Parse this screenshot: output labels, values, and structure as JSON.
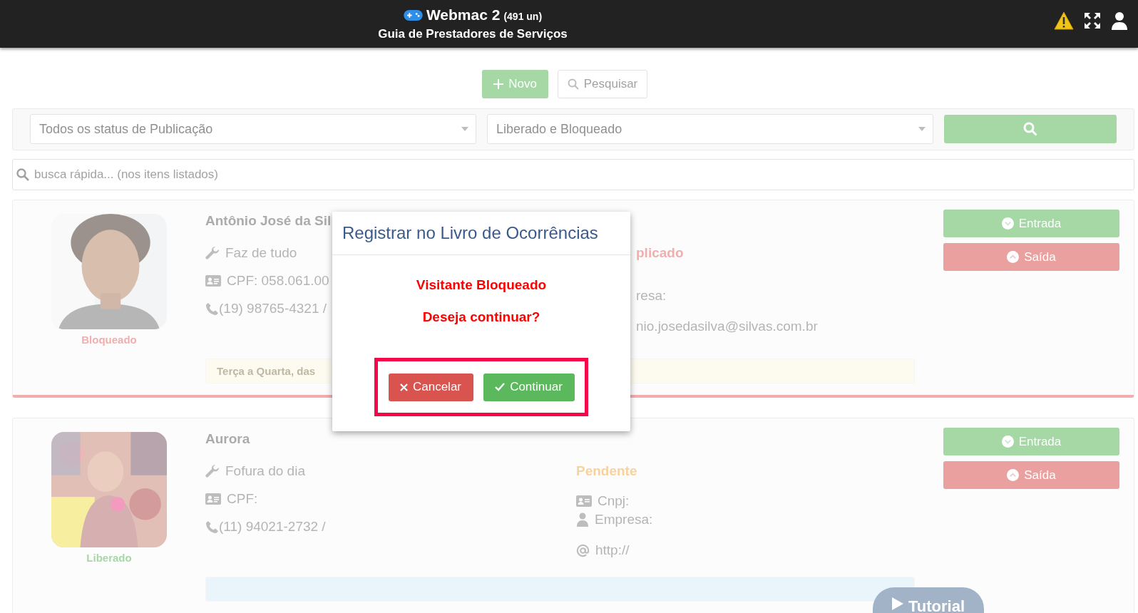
{
  "header": {
    "app_name": "Webmac 2",
    "count": "(491 un)",
    "subtitle": "Guia de Prestadores de Serviços"
  },
  "toolbar": {
    "new_button": "Novo",
    "search_button": "Pesquisar"
  },
  "filters": {
    "publication_status": "Todos os status de Publicação",
    "access_status": "Liberado e Bloqueado"
  },
  "quick_search": {
    "placeholder": "busca rápida... (nos itens listados)"
  },
  "cards": [
    {
      "name": "Antônio José da Sil",
      "service": "Faz de tudo",
      "cpf": "CPF: 058.061.00",
      "phone": "(19) 98765-4321 /",
      "access": {
        "label": "Bloqueado",
        "kind": "blocked"
      },
      "publication": {
        "text": "plicado",
        "kind": "blocked"
      },
      "details": [
        {
          "kind": "text",
          "text": "resa:"
        },
        {
          "kind": "text",
          "text": "nio.josedasilva@silvas.com.br"
        }
      ],
      "schedule": {
        "text": "Terça a Quarta, das",
        "kind": "warning"
      },
      "clipped": true,
      "entry_button": "Entrada",
      "exit_button": "Saída"
    },
    {
      "name": "Aurora",
      "service": "Fofura do dia",
      "cpf": "CPF:",
      "phone": "(11) 94021-2732 /",
      "access": {
        "label": "Liberado",
        "kind": "released"
      },
      "publication": {
        "text": "Pendente",
        "kind": "pending"
      },
      "details": [
        {
          "kind": "cnpj",
          "text": "Cnpj:"
        },
        {
          "kind": "company",
          "text": "Empresa:"
        },
        {
          "kind": "web",
          "text": "http://"
        }
      ],
      "schedule": {
        "kind": "info"
      },
      "clipped": false,
      "entry_button": "Entrada",
      "exit_button": "Saída"
    }
  ],
  "tutorial_button": "Tutorial",
  "modal": {
    "title": "Registrar no Livro de Ocorrências",
    "message": "Visitante Bloqueado",
    "question": "Deseja continuar?",
    "cancel_button": "Cancelar",
    "continue_button": "Continuar",
    "highlighted": true
  }
}
